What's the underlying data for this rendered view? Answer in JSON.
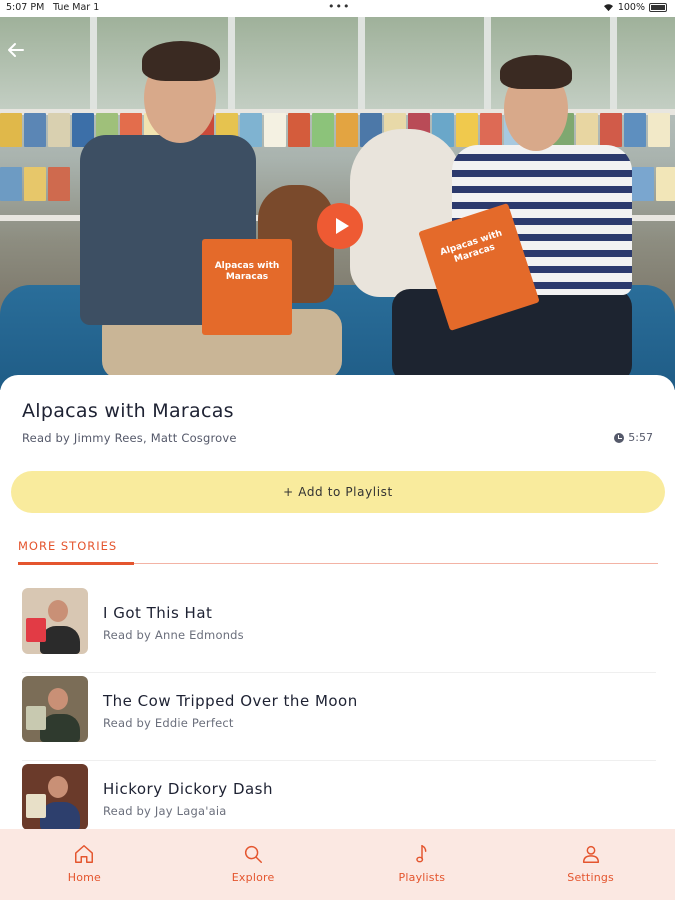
{
  "status_bar": {
    "time": "5:07 PM",
    "date": "Tue Mar 1",
    "dots": "•••",
    "battery": "100%"
  },
  "hero": {
    "back_icon": "arrow-left-icon",
    "play_icon": "play-icon",
    "book_cover_text": "Alpacas with Maracas"
  },
  "story": {
    "title": "Alpacas with Maracas",
    "read_by": "Read by Jimmy Rees, Matt Cosgrove",
    "duration": "5:57"
  },
  "add_playlist_label": "+ Add to Playlist",
  "section_title": "MORE STORIES",
  "more_stories": [
    {
      "title": "I Got This Hat",
      "read_by": "Read by Anne Edmonds",
      "thumb_bg": "#d8c7b3",
      "thumb_body": "#2b2b2b",
      "thumb_book": "#e23b45"
    },
    {
      "title": "The Cow Tripped Over the Moon",
      "read_by": "Read by Eddie Perfect",
      "thumb_bg": "#7b6d57",
      "thumb_body": "#2f3a2e",
      "thumb_book": "#c8c9b0"
    },
    {
      "title": "Hickory Dickory Dash",
      "read_by": "Read by Jay Laga'aia",
      "thumb_bg": "#6a3a2a",
      "thumb_body": "#2d3f6d",
      "thumb_book": "#e8e0c8"
    }
  ],
  "bottom_nav": [
    {
      "label": "Home",
      "icon": "home-icon"
    },
    {
      "label": "Explore",
      "icon": "search-icon"
    },
    {
      "label": "Playlists",
      "icon": "music-note-icon"
    },
    {
      "label": "Settings",
      "icon": "user-icon"
    }
  ],
  "colors": {
    "accent": "#e4552e",
    "playlist_button": "#f9eb9d",
    "nav_background": "#fbe8e2",
    "play_button": "#ee5a33"
  }
}
